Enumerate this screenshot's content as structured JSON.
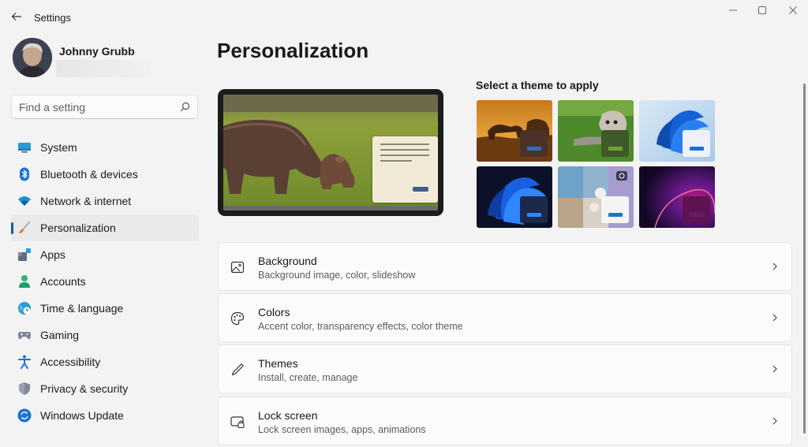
{
  "window": {
    "title": "Settings",
    "controls": {
      "minimize": "minimize-icon",
      "maximize": "maximize-icon",
      "close": "close-icon"
    }
  },
  "user": {
    "name": "Johnny Grubb"
  },
  "search": {
    "placeholder": "Find a setting",
    "value": ""
  },
  "sidebar": {
    "items": [
      {
        "label": "System",
        "icon": "monitor-icon"
      },
      {
        "label": "Bluetooth & devices",
        "icon": "bluetooth-icon"
      },
      {
        "label": "Network & internet",
        "icon": "wifi-icon"
      },
      {
        "label": "Personalization",
        "icon": "brush-icon",
        "active": true
      },
      {
        "label": "Apps",
        "icon": "apps-icon"
      },
      {
        "label": "Accounts",
        "icon": "person-icon"
      },
      {
        "label": "Time & language",
        "icon": "globe-clock-icon"
      },
      {
        "label": "Gaming",
        "icon": "gamepad-icon"
      },
      {
        "label": "Accessibility",
        "icon": "accessibility-icon"
      },
      {
        "label": "Privacy & security",
        "icon": "shield-icon"
      },
      {
        "label": "Windows Update",
        "icon": "update-icon"
      }
    ]
  },
  "main": {
    "title": "Personalization",
    "themes_heading": "Select a theme to apply",
    "themes": [
      {
        "name": "sunset-savanna"
      },
      {
        "name": "puppy-grass"
      },
      {
        "name": "light-bloom"
      },
      {
        "name": "dark-bloom"
      },
      {
        "name": "spotlight-collection"
      },
      {
        "name": "glow"
      }
    ],
    "cards": [
      {
        "title": "Background",
        "description": "Background image, color, slideshow",
        "icon": "image-icon"
      },
      {
        "title": "Colors",
        "description": "Accent color, transparency effects, color theme",
        "icon": "palette-icon"
      },
      {
        "title": "Themes",
        "description": "Install, create, manage",
        "icon": "pen-icon"
      },
      {
        "title": "Lock screen",
        "description": "Lock screen images, apps, animations",
        "icon": "lock-screen-icon"
      }
    ]
  },
  "colors": {
    "accent": "#005fb8",
    "background": "#f3f3f3",
    "card": "#fbfbfb"
  }
}
